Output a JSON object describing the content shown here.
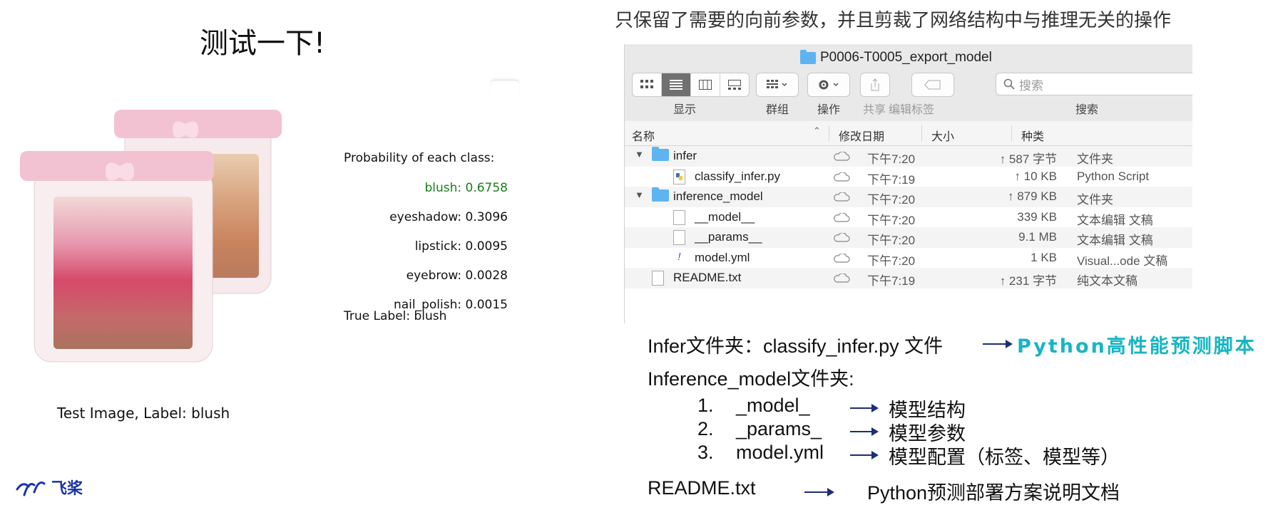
{
  "slide": {
    "title": "测试一下!",
    "right_header": "只保留了需要的向前参数，并且剪裁了网络结构中与推理无关的操作",
    "logo_text": "飞桨"
  },
  "prediction": {
    "heading": "Probability of each class:",
    "probs": [
      {
        "label": "blush: 0.6758",
        "color": "#1a7f1a"
      },
      {
        "label": "eyeshadow: 0.3096",
        "color": "#111111"
      },
      {
        "label": "lipstick: 0.0095",
        "color": "#111111"
      },
      {
        "label": "eyebrow: 0.0028",
        "color": "#111111"
      },
      {
        "label": "nail_polish: 0.0015",
        "color": "#111111"
      }
    ],
    "true_label": "True Label: blush",
    "caption": "Test Image, Label: blush"
  },
  "finder": {
    "window_title": "P0006-T0005_export_model",
    "toolbar": {
      "display_label": "显示",
      "group_label": "群组",
      "action_label": "操作",
      "share_label": "共享",
      "edit_tags_label": "编辑标签",
      "search_label": "搜索",
      "search_placeholder": "搜索"
    },
    "columns": {
      "name": "名称",
      "date": "修改日期",
      "size": "大小",
      "kind": "种类"
    },
    "rows": [
      {
        "name": "infer",
        "date": "下午7:20",
        "size": "↑ 587 字节",
        "kind": "文件夹",
        "type": "folder",
        "level": 0,
        "expanded": true
      },
      {
        "name": "classify_infer.py",
        "date": "下午7:19",
        "size": "↑ 10 KB",
        "kind": "Python Script",
        "type": "python",
        "level": 1
      },
      {
        "name": "inference_model",
        "date": "下午7:20",
        "size": "↑ 879 KB",
        "kind": "文件夹",
        "type": "folder",
        "level": 0,
        "expanded": true
      },
      {
        "name": "__model__",
        "date": "下午7:20",
        "size": "339 KB",
        "kind": "文本编辑 文稿",
        "type": "doc",
        "level": 1
      },
      {
        "name": "__params__",
        "date": "下午7:20",
        "size": "9.1 MB",
        "kind": "文本编辑 文稿",
        "type": "doc",
        "level": 1
      },
      {
        "name": "model.yml",
        "date": "下午7:20",
        "size": "1 KB",
        "kind": "Visual...ode 文稿",
        "type": "yml",
        "level": 1
      },
      {
        "name": "README.txt",
        "date": "下午7:19",
        "size": "↑ 231 字节",
        "kind": "纯文本文稿",
        "type": "doc",
        "level": 0
      }
    ]
  },
  "explain": {
    "infer_line": "Infer文件夹：classify_infer.py 文件",
    "infer_desc": "Python高性能预测脚本",
    "inference_line": "Inference_model文件夹:",
    "items": [
      {
        "num": "1.",
        "name": "_model_",
        "desc": "模型结构"
      },
      {
        "num": "2.",
        "name": "_params_",
        "desc": "模型参数"
      },
      {
        "num": "3.",
        "name": "model.yml",
        "desc": "模型配置（标签、模型等）"
      }
    ],
    "readme_name": "README.txt",
    "readme_desc": "Python预测部署方案说明文档"
  }
}
